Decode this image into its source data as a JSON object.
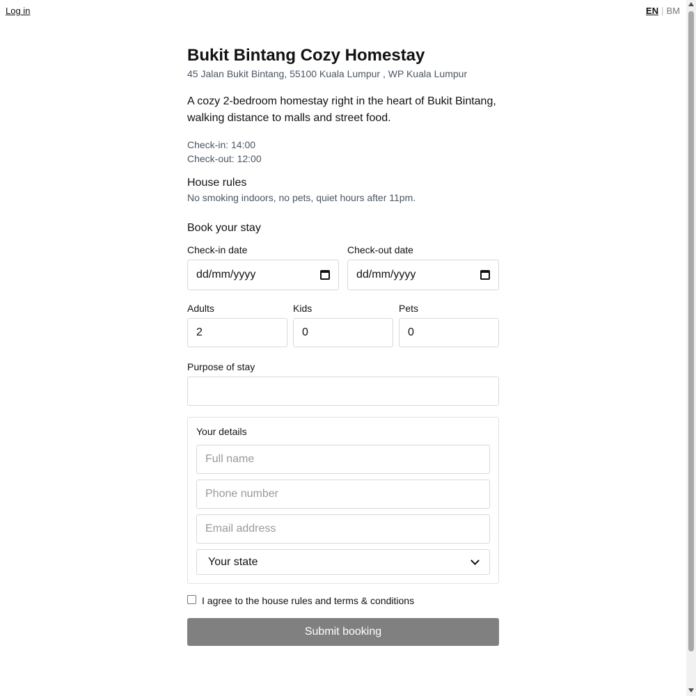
{
  "topbar": {
    "login_label": "Log in",
    "lang_active": "EN",
    "lang_separator": "|",
    "lang_inactive": "BM"
  },
  "listing": {
    "title": "Bukit Bintang Cozy Homestay",
    "address": "45 Jalan Bukit Bintang, 55100 Kuala Lumpur , WP Kuala Lumpur",
    "description": "A cozy 2-bedroom homestay right in the heart of Bukit Bintang, walking distance to malls and street food.",
    "check_in": "Check-in: 14:00",
    "check_out": "Check-out: 12:00",
    "rules_title": "House rules",
    "rules_text": "No smoking indoors, no pets, quiet hours after 11pm."
  },
  "booking": {
    "title": "Book your stay",
    "checkin_label": "Check-in date",
    "checkin_value": "dd/mm/yyyy",
    "checkout_label": "Check-out date",
    "checkout_value": "dd/mm/yyyy",
    "adults_label": "Adults",
    "adults_value": "2",
    "kids_label": "Kids",
    "kids_value": "0",
    "pets_label": "Pets",
    "pets_value": "0",
    "purpose_label": "Purpose of stay",
    "purpose_value": ""
  },
  "details": {
    "legend": "Your details",
    "name_placeholder": "Full name",
    "phone_placeholder": "Phone number",
    "email_placeholder": "Email address",
    "state_selected": "Your state"
  },
  "agree_label": "I agree to the house rules and terms & conditions",
  "submit_label": "Submit booking",
  "icons": {
    "calendar": "calendar-icon",
    "select": "chevron-down-icon"
  },
  "colors": {
    "submit_bg": "#808080",
    "muted_text": "#4a5563"
  }
}
